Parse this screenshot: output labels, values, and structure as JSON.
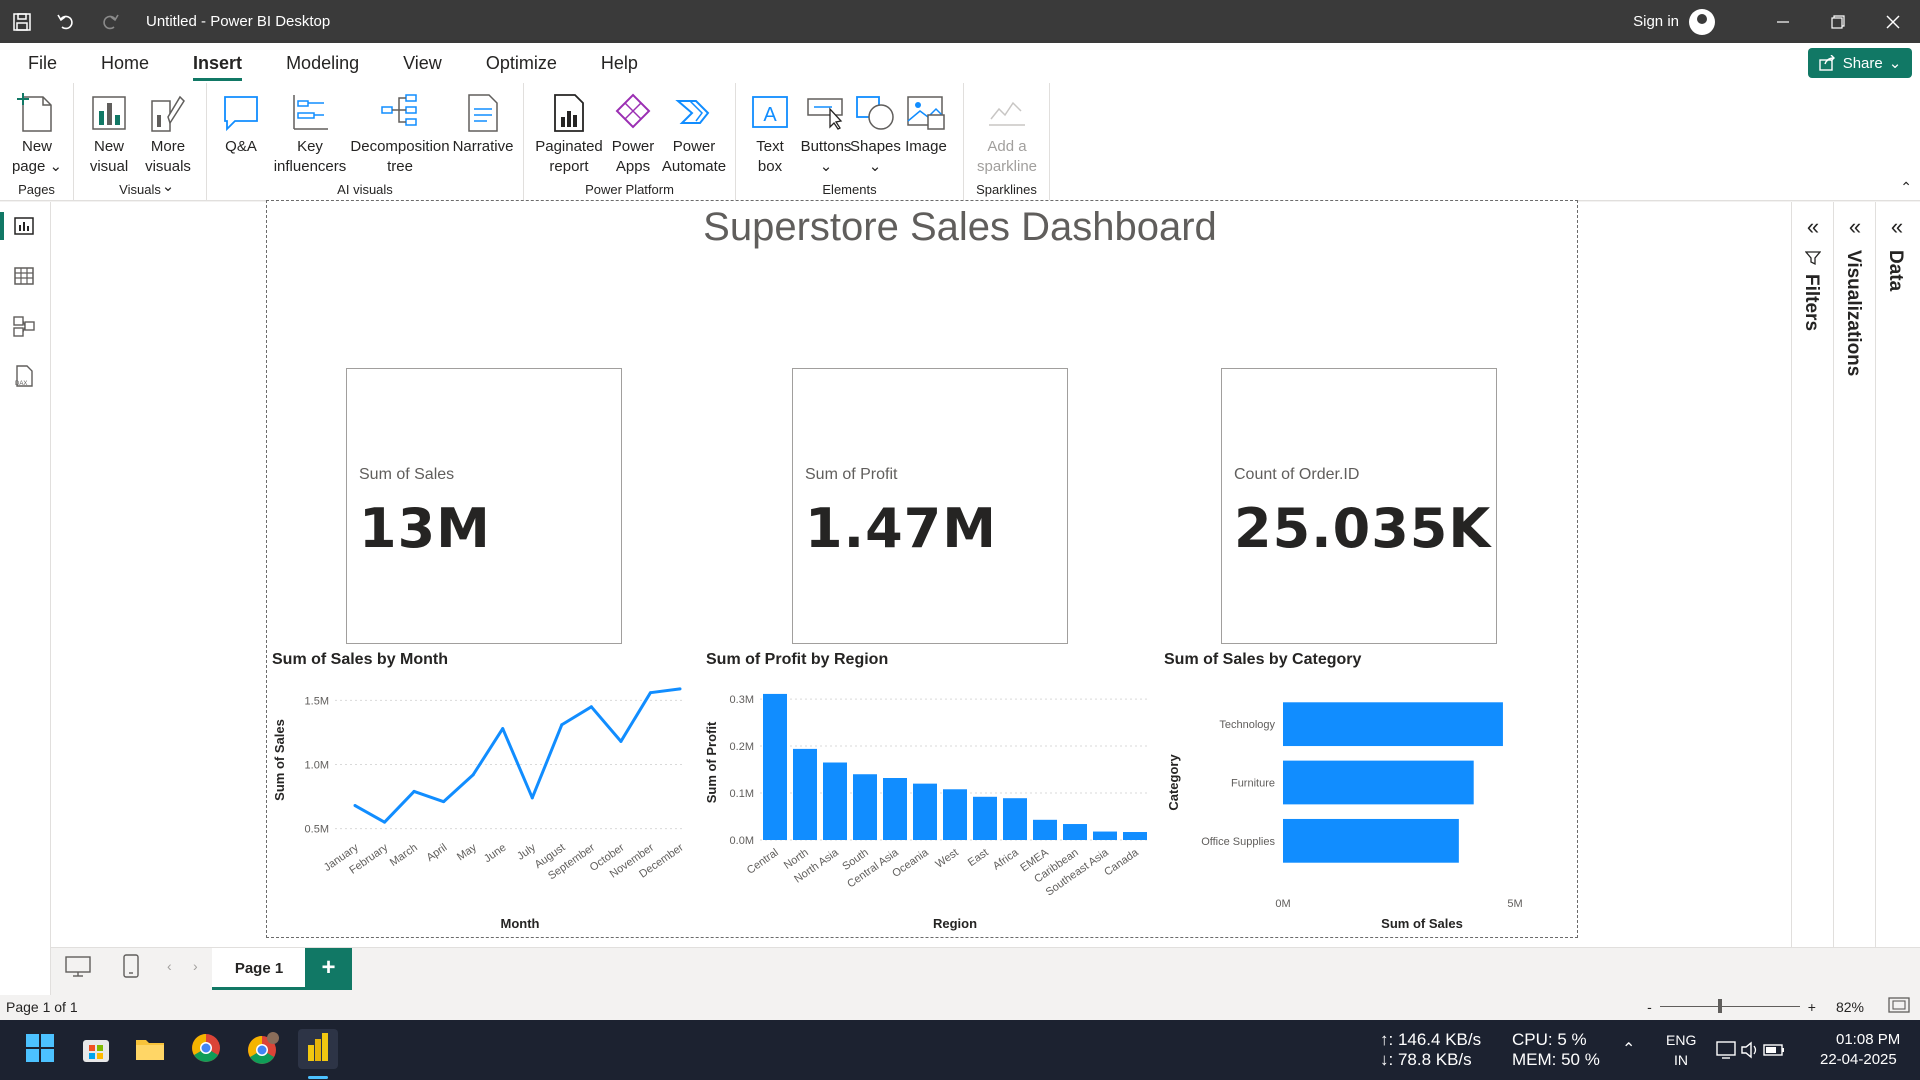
{
  "window": {
    "title": "Untitled - Power BI Desktop",
    "sign_in": "Sign in"
  },
  "menu": {
    "tabs": [
      "File",
      "Home",
      "Insert",
      "Modeling",
      "View",
      "Optimize",
      "Help"
    ],
    "active": "Insert",
    "share": "Share"
  },
  "ribbon": {
    "pages": {
      "label": "Pages",
      "new_page": [
        "New",
        "page"
      ]
    },
    "visuals": {
      "label": "Visuals",
      "new_visual": [
        "New",
        "visual"
      ],
      "more_visuals": [
        "More",
        "visuals"
      ]
    },
    "ai_visuals": {
      "label": "AI visuals",
      "qa": "Q&A",
      "key_influencers": [
        "Key",
        "influencers"
      ],
      "decomposition_tree": [
        "Decomposition",
        "tree"
      ],
      "narrative": "Narrative"
    },
    "power_platform": {
      "label": "Power Platform",
      "paginated_report": [
        "Paginated",
        "report"
      ],
      "power_apps": [
        "Power",
        "Apps"
      ],
      "power_automate": [
        "Power",
        "Automate"
      ]
    },
    "elements": {
      "label": "Elements",
      "text_box": [
        "Text",
        "box"
      ],
      "buttons": "Buttons",
      "shapes": "Shapes",
      "image": "Image"
    },
    "sparklines": {
      "label": "Sparklines",
      "add_sparkline": [
        "Add a",
        "sparkline"
      ]
    }
  },
  "dashboard": {
    "title": "Superstore Sales Dashboard",
    "cards": [
      {
        "label": "Sum of Sales",
        "value": "13M"
      },
      {
        "label": "Sum of Profit",
        "value": "1.47M"
      },
      {
        "label": "Count of Order.ID",
        "value": "25.035K"
      }
    ]
  },
  "chart_data": [
    {
      "type": "line",
      "title": "Sum of Sales by Month",
      "xlabel": "Month",
      "ylabel": "Sum of Sales",
      "categories": [
        "January",
        "February",
        "March",
        "April",
        "May",
        "June",
        "July",
        "August",
        "September",
        "October",
        "November",
        "December"
      ],
      "values": [
        0.68,
        0.55,
        0.79,
        0.71,
        0.92,
        1.28,
        0.74,
        1.31,
        1.45,
        1.18,
        1.56,
        1.59
      ],
      "yticks": [
        "0.5M",
        "1.0M",
        "1.5M"
      ],
      "ytick_values": [
        0.5,
        1.0,
        1.5
      ],
      "ylim": [
        0.45,
        1.62
      ],
      "color": "#118DFF"
    },
    {
      "type": "bar",
      "title": "Sum of Profit by Region",
      "xlabel": "Region",
      "ylabel": "Sum of Profit",
      "categories": [
        "Central",
        "North",
        "North Asia",
        "South",
        "Central Asia",
        "Oceania",
        "West",
        "East",
        "Africa",
        "EMEA",
        "Caribbean",
        "Southeast Asia",
        "Canada"
      ],
      "values": [
        0.311,
        0.194,
        0.165,
        0.14,
        0.132,
        0.12,
        0.108,
        0.092,
        0.089,
        0.043,
        0.034,
        0.018,
        0.017
      ],
      "yticks": [
        "0.0M",
        "0.1M",
        "0.2M",
        "0.3M"
      ],
      "ytick_values": [
        0,
        0.1,
        0.2,
        0.3
      ],
      "ylim": [
        0,
        0.33
      ],
      "color": "#118DFF"
    },
    {
      "type": "bar",
      "orientation": "horizontal",
      "title": "Sum of Sales by Category",
      "xlabel": "Sum of Sales",
      "ylabel": "Category",
      "categories": [
        "Technology",
        "Furniture",
        "Office Supplies"
      ],
      "values": [
        4.74,
        4.11,
        3.79
      ],
      "xticks": [
        "0M",
        "5M"
      ],
      "xtick_values": [
        0,
        5
      ],
      "xlim": [
        0,
        5
      ],
      "color": "#118DFF"
    }
  ],
  "right_panes": [
    "Filters",
    "Visualizations",
    "Data"
  ],
  "page_tabs": {
    "current": "Page 1",
    "add": "+"
  },
  "status": {
    "page_info": "Page 1 of 1",
    "zoom": "82%",
    "minus": "-",
    "plus": "+"
  },
  "taskbar": {
    "net_up": "↑: 146.4 KB/s",
    "net_down": "↓: 78.8 KB/s",
    "cpu": "CPU: 5 %",
    "mem": "MEM: 50 %",
    "lang1": "ENG",
    "lang2": "IN",
    "time": "01:08 PM",
    "date": "22-04-2025"
  }
}
